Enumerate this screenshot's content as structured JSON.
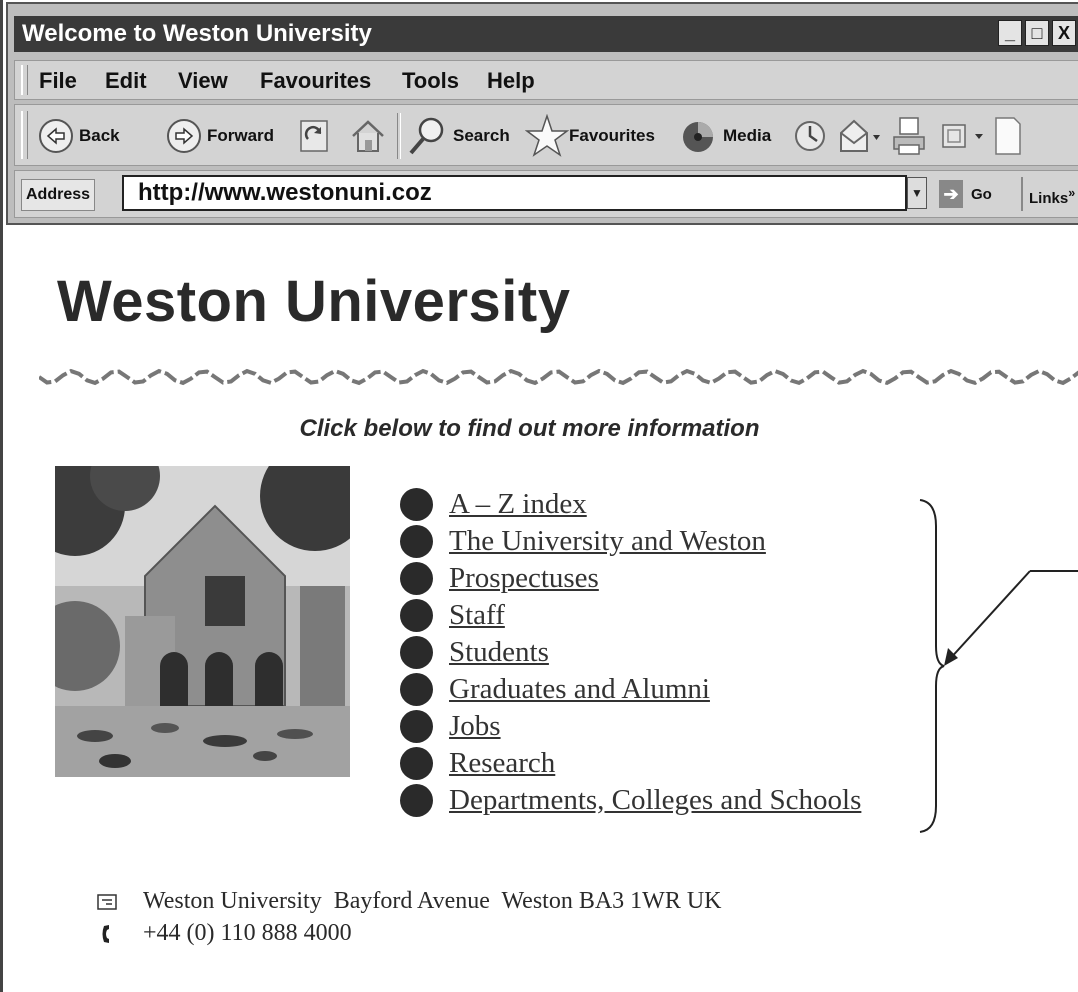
{
  "window": {
    "title": "Welcome to Weston University",
    "buttons": [
      "_",
      "□",
      "X"
    ]
  },
  "menu": [
    "File",
    "Edit",
    "View",
    "Favourites",
    "Tools",
    "Help"
  ],
  "toolbar": {
    "back": "Back",
    "forward": "Forward",
    "search": "Search",
    "favourites": "Favourites",
    "media": "Media"
  },
  "address": {
    "label": "Address",
    "url": "http://www.westonuni.coz",
    "go": "Go",
    "links": "Links"
  },
  "page": {
    "heading": "Weston University",
    "subtitle": "Click below to find out more information",
    "links": [
      "A – Z index",
      "The University and Weston",
      "Prospectuses",
      "Staff",
      "Students",
      "Graduates and Alumni",
      "Jobs",
      "Research",
      "Departments, Colleges and Schools"
    ],
    "address_line": "Weston University  Bayford Avenue  Weston BA3 1WR UK",
    "phone": "+44 (0) 110 888 4000"
  },
  "icons": [
    "back-icon",
    "forward-icon",
    "refresh-icon",
    "home-icon",
    "search-icon",
    "favourites-star-icon",
    "media-icon",
    "history-icon",
    "mail-icon",
    "print-icon",
    "edit-icon",
    "page-icon",
    "envelope-icon",
    "phone-icon"
  ]
}
